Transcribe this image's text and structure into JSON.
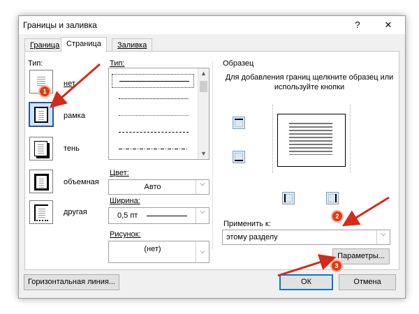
{
  "window": {
    "title": "Границы и заливка",
    "help_symbol": "?",
    "close_symbol": "✕"
  },
  "tabs": [
    {
      "label": "Граница",
      "active": false
    },
    {
      "label": "Страница",
      "active": true
    },
    {
      "label": "Заливка",
      "active": false
    }
  ],
  "type_section": {
    "label": "Тип:",
    "presets": [
      {
        "label": "нет",
        "icon": "none-border-icon",
        "selected": false
      },
      {
        "label": "рамка",
        "icon": "box-border-icon",
        "selected": true
      },
      {
        "label": "тень",
        "icon": "shadow-border-icon",
        "selected": false
      },
      {
        "label": "объемная",
        "icon": "3d-border-icon",
        "selected": false
      },
      {
        "label": "другая",
        "icon": "custom-border-icon",
        "selected": false
      }
    ]
  },
  "style_section": {
    "label": "Тип:",
    "styles": [
      "solid",
      "dotted",
      "dotted-fine",
      "dashed",
      "dash-dot"
    ]
  },
  "color": {
    "label": "Цвет:",
    "value": "Авто"
  },
  "width": {
    "label": "Ширина:",
    "value": "0,5 пт"
  },
  "art": {
    "label": "Рисунок:",
    "value": "(нет)"
  },
  "preview_section": {
    "label": "Образец",
    "hint": "Для добавления границ щелкните образец или используйте кнопки"
  },
  "apply_to": {
    "label": "Применить к:",
    "value": "этому разделу"
  },
  "buttons": {
    "options": "Параметры...",
    "horizontal_line": "Горизонтальная линия...",
    "ok": "ОК",
    "cancel": "Отмена"
  },
  "annotations": [
    "1",
    "2",
    "3"
  ],
  "colors": {
    "accent": "#2b579a",
    "annotation": "#e03a12",
    "arrow": "#d42a1a"
  }
}
